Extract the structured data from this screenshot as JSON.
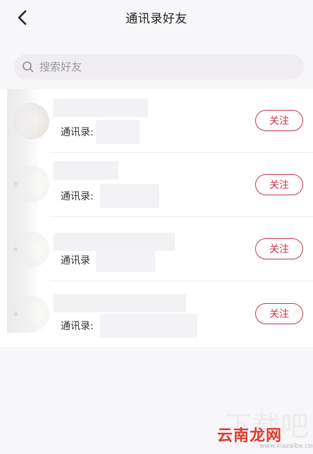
{
  "header": {
    "title": "通讯录好友",
    "back_icon": "chevron-left-icon"
  },
  "search": {
    "placeholder": "搜索好友",
    "value": "",
    "icon": "search-icon"
  },
  "friends": [
    {
      "name": "",
      "contact_label": "通讯录:",
      "contact_name": "",
      "follow_label": "关注"
    },
    {
      "name": "",
      "contact_label": "通讯录:",
      "contact_name": "",
      "follow_label": "关注"
    },
    {
      "name": "",
      "contact_label": "通讯录",
      "contact_name": "",
      "follow_label": "关注"
    },
    {
      "name": "",
      "contact_label": "通讯录:",
      "contact_name": "",
      "follow_label": "关注"
    }
  ],
  "colors": {
    "accent": "#c8354a",
    "background": "#f7f6f8",
    "search_bg": "#efedf0"
  },
  "watermark": {
    "brand": "云南龙网",
    "faint": "下载吧",
    "url": "www.xiazaiba.com"
  }
}
